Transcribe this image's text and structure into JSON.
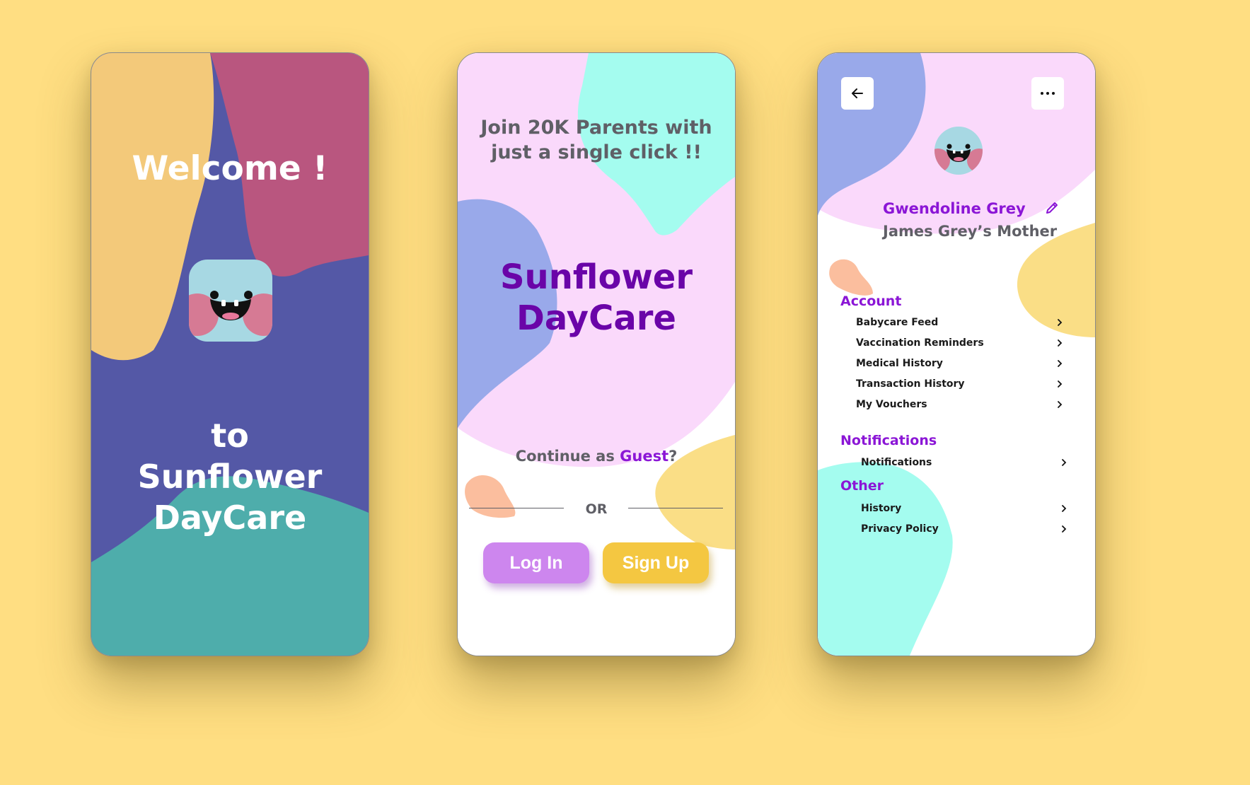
{
  "colors": {
    "page_bg": "#FFDE82",
    "purple_text": "#8B16D6",
    "brand_purple": "#6A04A8",
    "gray_text": "#5f5f66",
    "login_button": "#CD86EE",
    "signup_button": "#F4C741",
    "welcome_orange": "#F3C97A",
    "welcome_rose": "#B9567F",
    "welcome_indigo": "#5458A6",
    "welcome_teal": "#4EADAB",
    "pink_bg": "#FAD9FB",
    "aqua_blob": "#A4FCEF",
    "periwinkle_blob": "#99A9EA",
    "peach_blob": "#FBBE9E",
    "yellow_blob": "#FADE86",
    "mascot_face": "#A7D8E3",
    "mascot_cheek": "#D67A94"
  },
  "welcome_screen": {
    "title": "Welcome !",
    "to_word": "to",
    "app_name_line1": "Sunflower",
    "app_name_line2": "DayCare",
    "mascot_icon": "smiling-monster-icon"
  },
  "auth_screen": {
    "headline": "Join 20K Parents with just a single click !!",
    "brand_line1": "Sunflower",
    "brand_line2": "DayCare",
    "guest_prefix": "Continue as ",
    "guest_link": "Guest",
    "guest_suffix": "?",
    "divider_text": "OR",
    "login_label": "Log In",
    "signup_label": "Sign Up"
  },
  "profile_screen": {
    "back_icon": "arrow-left-icon",
    "menu_icon": "more-horizontal-icon",
    "edit_icon": "pencil-icon",
    "user_name": "Gwendoline Grey",
    "user_role": "James Grey’s Mother",
    "sections": [
      {
        "title": "Account",
        "items": [
          "Babycare Feed",
          "Vaccination Reminders",
          "Medical History",
          "Transaction History",
          "My Vouchers"
        ]
      },
      {
        "title": "Notifications",
        "items": [
          "Notifications"
        ]
      },
      {
        "title": "Other",
        "items": [
          "History",
          "Privacy Policy"
        ]
      }
    ]
  }
}
